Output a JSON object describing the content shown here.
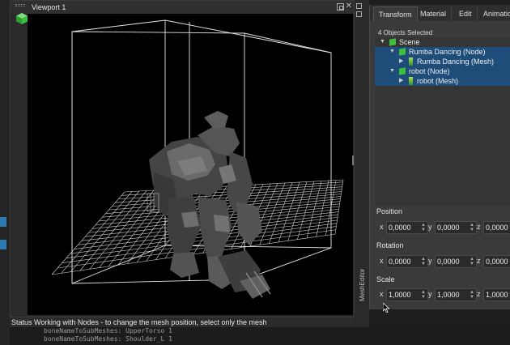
{
  "viewport": {
    "title": "Viewport 1",
    "close_glyph": "✕"
  },
  "status_text": "Status Working with Nodes - to change the mesh position, select only the mesh",
  "console": {
    "lines": [
      "boneNameToSubMeshes: UpperTorso 1",
      "boneNameToSubMeshes: Shoulder_L 1"
    ]
  },
  "side_dock": {
    "label": "MeshEditor"
  },
  "tabs": [
    "Transform",
    "Material",
    "Edit",
    "Animatio"
  ],
  "selection_count": "4 Objects Selected",
  "tree": [
    {
      "label": "Scene",
      "arrow": "▼",
      "icon": "cube-icon",
      "selected": false
    },
    {
      "label": "Rumba Dancing (Node)",
      "arrow": "▼",
      "icon": "cube-icon",
      "selected": true
    },
    {
      "label": "Rumba Dancing (Mesh)",
      "arrow": "▶",
      "icon": "mesh-icon",
      "selected": true
    },
    {
      "label": "robot (Node)",
      "arrow": "▼",
      "icon": "cube-icon",
      "selected": true
    },
    {
      "label": "robot (Mesh)",
      "arrow": "▶",
      "icon": "mesh-icon",
      "selected": true
    }
  ],
  "transform": {
    "position": {
      "label": "Position",
      "x": "0,0000",
      "y": "0,0000",
      "z": "0,0000"
    },
    "rotation": {
      "label": "Rotation",
      "x": "0,0000",
      "y": "0,0000",
      "z": "0,0000"
    },
    "scale": {
      "label": "Scale",
      "x": "1,0000",
      "y": "1,0000",
      "z": "1,0000"
    }
  },
  "axes": {
    "x": "x",
    "y": "y",
    "z": "z"
  },
  "colors": {
    "selection": "#1f4d7a",
    "accent_blue": "#2b7bb0",
    "node_icon": "#3bbf3b"
  }
}
